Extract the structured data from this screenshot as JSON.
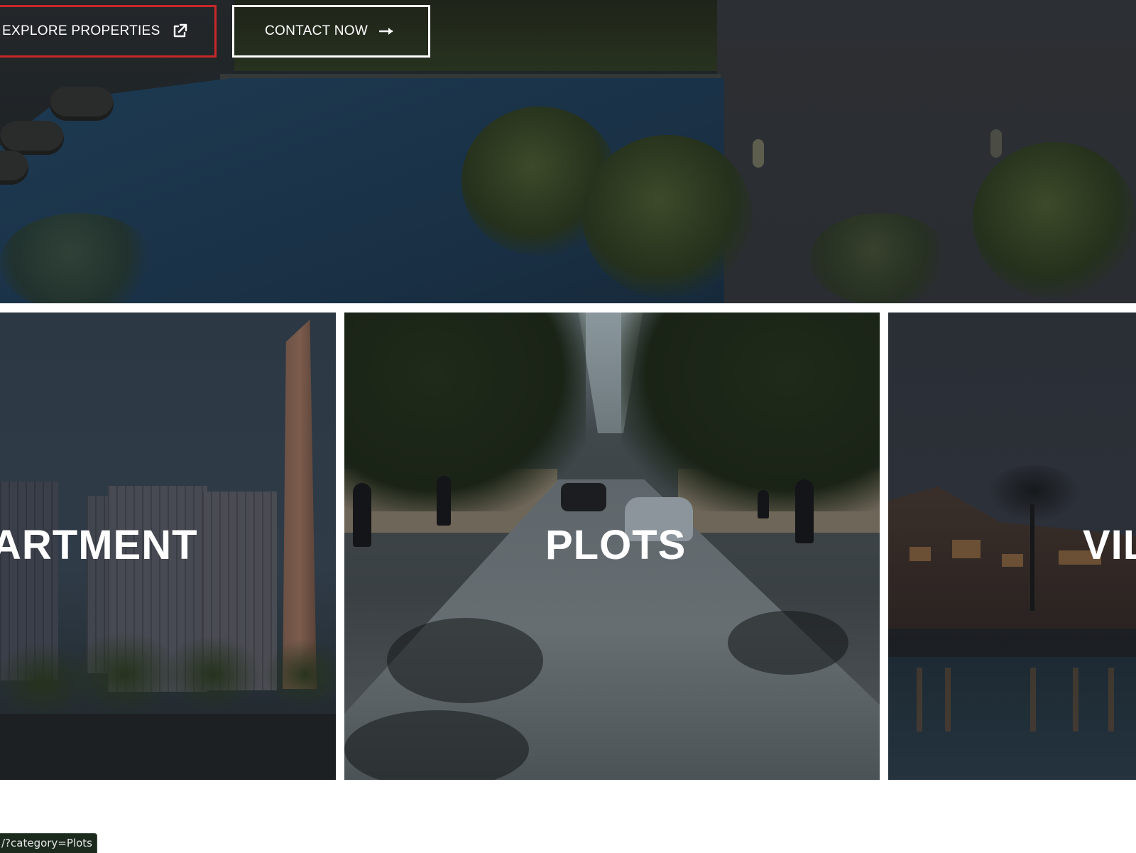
{
  "hero": {
    "explore_button": {
      "label": "EXPLORE PROPERTIES",
      "icon": "external-link-icon",
      "border_color": "#c7282a"
    },
    "contact_button": {
      "label": "CONTACT NOW",
      "icon": "arrow-right-icon",
      "border_color": "#ffffff"
    }
  },
  "categories": [
    {
      "label": "ARTMENT"
    },
    {
      "label": "PLOTS"
    },
    {
      "label": "VIL"
    }
  ],
  "status_bar": {
    "url": "/?category=Plots"
  }
}
